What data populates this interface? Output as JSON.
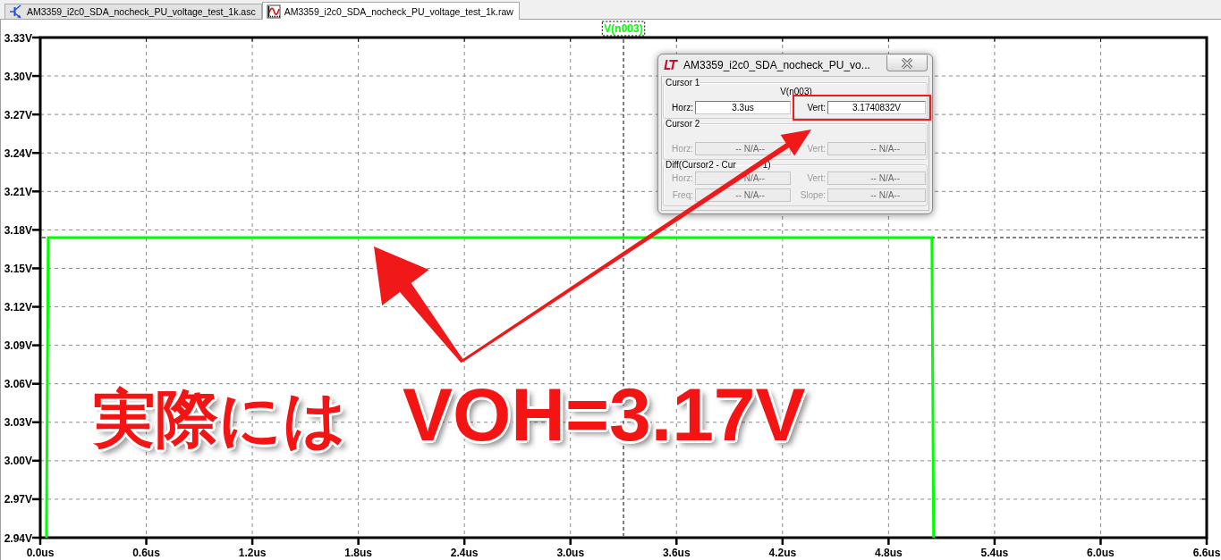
{
  "tabs": [
    {
      "label": "AM3359_i2c0_SDA_nocheck_PU_voltage_test_1k.asc",
      "kind": "schematic",
      "selected": false
    },
    {
      "label": "AM3359_i2c0_SDA_nocheck_PU_voltage_test_1k.raw",
      "kind": "waveform",
      "selected": true
    }
  ],
  "plot": {
    "chart_data": {
      "type": "line",
      "x": [
        0.035,
        0.045,
        5.045,
        5.055
      ],
      "series": [
        {
          "name": "V(n003)",
          "color": "#00ff00",
          "values": [
            2.94,
            3.174,
            3.174,
            2.94
          ]
        }
      ],
      "xlim": [
        0,
        6.6
      ],
      "ylim": [
        2.94,
        3.33
      ],
      "xticks": [
        {
          "value": 0,
          "label": "0.0us"
        },
        {
          "value": 0.6,
          "label": "0.6us"
        },
        {
          "value": 1.2,
          "label": "1.2us"
        },
        {
          "value": 1.8,
          "label": "1.8us"
        },
        {
          "value": 2.4,
          "label": "2.4us"
        },
        {
          "value": 3.0,
          "label": "3.0us"
        },
        {
          "value": 3.6,
          "label": "3.6us"
        },
        {
          "value": 4.2,
          "label": "4.2us"
        },
        {
          "value": 4.8,
          "label": "4.8us"
        },
        {
          "value": 5.4,
          "label": "5.4us"
        },
        {
          "value": 6.0,
          "label": "6.0us"
        },
        {
          "value": 6.6,
          "label": "6.6us"
        }
      ],
      "yticks": [
        {
          "value": 2.94,
          "label": "2.94V"
        },
        {
          "value": 2.97,
          "label": "2.97V"
        },
        {
          "value": 3.0,
          "label": "3.00V"
        },
        {
          "value": 3.03,
          "label": "3.03V"
        },
        {
          "value": 3.06,
          "label": "3.06V"
        },
        {
          "value": 3.09,
          "label": "3.09V"
        },
        {
          "value": 3.12,
          "label": "3.12V"
        },
        {
          "value": 3.15,
          "label": "3.15V"
        },
        {
          "value": 3.18,
          "label": "3.18V"
        },
        {
          "value": 3.21,
          "label": "3.21V"
        },
        {
          "value": 3.24,
          "label": "3.24V"
        },
        {
          "value": 3.27,
          "label": "3.27V"
        },
        {
          "value": 3.3,
          "label": "3.30V"
        },
        {
          "value": 3.33,
          "label": "3.33V"
        }
      ],
      "grid": true,
      "ref_lines": [
        {
          "axis": "x",
          "value": 3.3
        },
        {
          "axis": "y",
          "value": 3.174
        }
      ]
    }
  },
  "cursor_dialog": {
    "title": "AM3359_i2c0_SDA_nocheck_PU_vo...",
    "groups": [
      {
        "kind": "cursor",
        "label": "Cursor 1",
        "trace": "V(n003)",
        "fields": [
          {
            "label": "Horz:",
            "value": "3.3us",
            "disabled": false,
            "highlighted": false
          },
          {
            "label": "Vert:",
            "value": "3.1740832V",
            "disabled": false,
            "highlighted": true
          }
        ]
      },
      {
        "kind": "cursor",
        "label": "Cursor 2",
        "fields": [
          {
            "label": "Horz:",
            "value": "-- N/A--",
            "disabled": true,
            "highlighted": false
          },
          {
            "label": "Vert:",
            "value": "-- N/A--",
            "disabled": true,
            "highlighted": false
          }
        ]
      },
      {
        "kind": "diff",
        "label": "Diff(Cursor2 - Cur",
        "label_tail": "1)",
        "fields": [
          {
            "label": "Horz:",
            "value": "N/A--",
            "disabled": true,
            "highlighted": false
          },
          {
            "label": "Vert:",
            "value": "-- N/A--",
            "disabled": true,
            "highlighted": false
          },
          {
            "label": "Freq:",
            "value": "-- N/A--",
            "disabled": true,
            "highlighted": false
          },
          {
            "label": "Slope:",
            "value": "-- N/A--",
            "disabled": true,
            "highlighted": false
          }
        ]
      }
    ]
  },
  "annotation": {
    "label": "実際には",
    "value": "VOH=3.17V"
  }
}
